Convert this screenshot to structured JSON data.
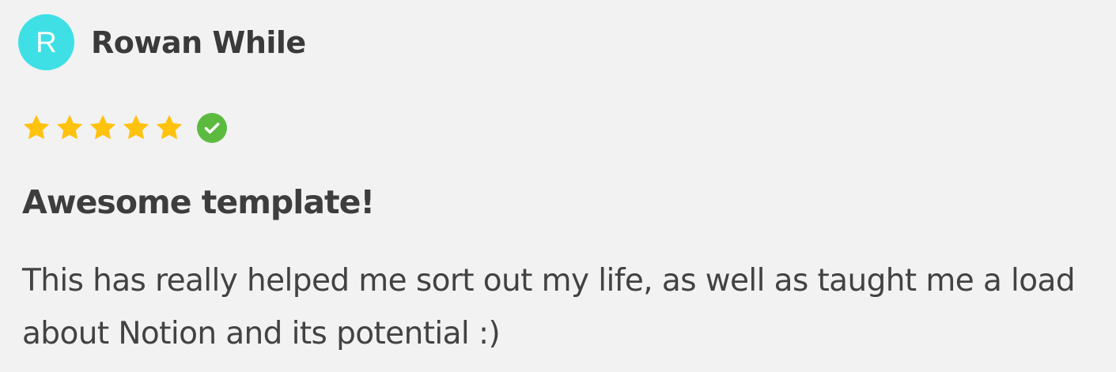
{
  "review": {
    "avatar": {
      "initial": "R",
      "color": "#3ee0e6"
    },
    "reviewer_name": "Rowan While",
    "rating": {
      "value": 5,
      "max": 5,
      "star_color": "#ffc20e",
      "icon": "star-icon"
    },
    "verified": {
      "icon": "check-circle-icon",
      "color": "#5cbb3f"
    },
    "title": "Awesome template!",
    "body": "This has really helped me sort out my life, as well as taught me a load about Notion and its potential :)"
  }
}
